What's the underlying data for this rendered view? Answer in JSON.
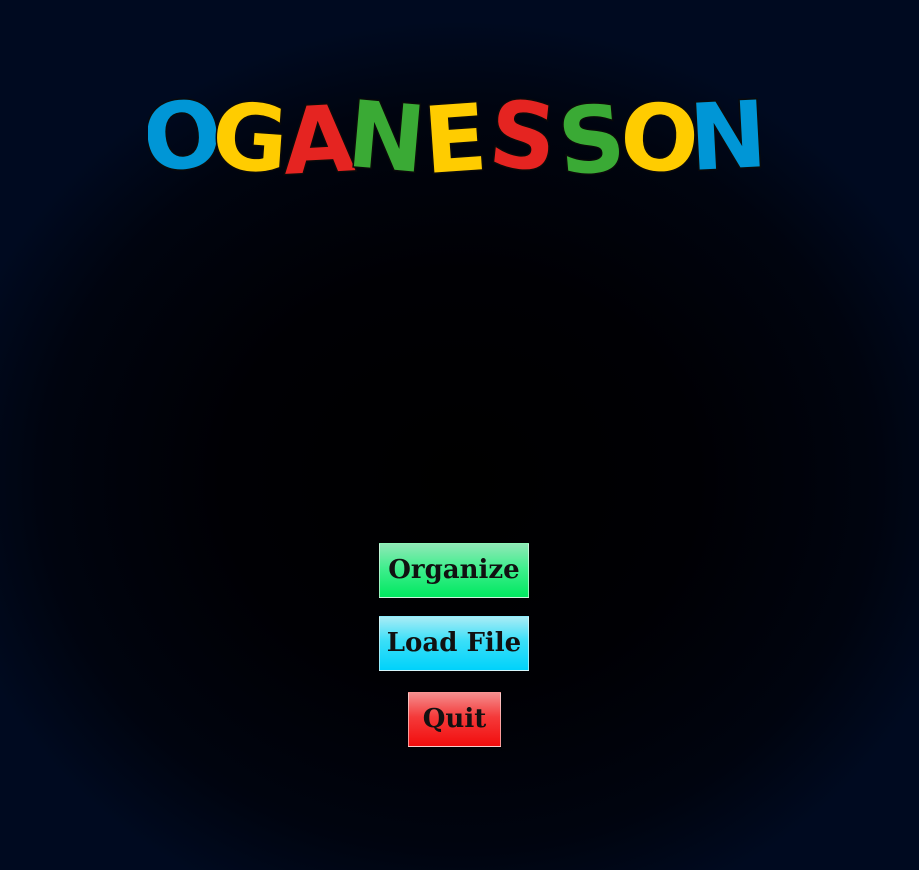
{
  "logo": {
    "text": "OGANESSON",
    "letters": [
      {
        "char": "O",
        "color": "#0096d6"
      },
      {
        "char": "G",
        "color": "#ffcc00"
      },
      {
        "char": "A",
        "color": "#e52421"
      },
      {
        "char": "N",
        "color": "#3aaa35"
      },
      {
        "char": "E",
        "color": "#ffcc00"
      },
      {
        "char": "S",
        "color": "#e52421"
      },
      {
        "char": "S",
        "color": "#3aaa35"
      },
      {
        "char": "O",
        "color": "#ffcc00"
      },
      {
        "char": "N",
        "color": "#0096d6"
      }
    ]
  },
  "menu": {
    "organize_label": "Organize",
    "load_file_label": "Load File",
    "quit_label": "Quit"
  },
  "colors": {
    "organize": "#1ff27a",
    "load_file": "#1fdcfb",
    "quit": "#f51f1f",
    "background": "#000000"
  }
}
